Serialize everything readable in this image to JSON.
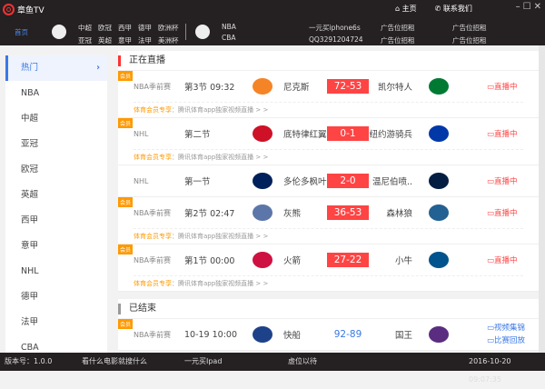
{
  "app": {
    "title": "章鱼TV",
    "home": "主页",
    "contact": "联系我们"
  },
  "nav": {
    "home": "首页",
    "football": [
      "中超",
      "欧冠",
      "西甲",
      "德甲",
      "欧洲杯",
      "亚冠",
      "英超",
      "意甲",
      "法甲",
      "美洲杯"
    ],
    "basketball": [
      "NBA",
      "CBA"
    ],
    "promo1": [
      "一元买iphone6s",
      "QQ3291204724"
    ],
    "ad2": [
      "广告位招租",
      "广告位招租"
    ],
    "ad3": [
      "广告位招租",
      "广告位招租"
    ]
  },
  "sidebar": {
    "items": [
      "热门",
      "NBA",
      "中超",
      "亚冠",
      "欧冠",
      "英超",
      "西甲",
      "意甲",
      "NHL",
      "德甲",
      "法甲",
      "CBA"
    ]
  },
  "live": {
    "title": "正在直播",
    "promo_label": "体育会员专享",
    "promo_text": "：腾讯体育app独家视频直播 > >",
    "badge": "会员",
    "rows": [
      {
        "league": "NBA季前赛",
        "time": "第3节 09:32",
        "home": "尼克斯",
        "score": "72-53",
        "away": "凯尔特人",
        "status": "直播中",
        "home_color": "#f58426",
        "away_color": "#007a33"
      },
      {
        "league": "NHL",
        "time": "第二节",
        "home": "底特律红翼",
        "score": "0-1",
        "away": "纽约游骑兵",
        "status": "直播中",
        "home_color": "#ce1126",
        "away_color": "#0038a8"
      },
      {
        "league": "NHL",
        "time": "第一节",
        "home": "多伦多枫叶",
        "score": "2-0",
        "away": "温尼伯喷..",
        "status": "直播中",
        "home_color": "#00205b",
        "away_color": "#041e42"
      },
      {
        "league": "NBA季前赛",
        "time": "第2节 02:47",
        "home": "灰熊",
        "score": "36-53",
        "away": "森林狼",
        "status": "直播中",
        "home_color": "#5d76a9",
        "away_color": "#236192"
      },
      {
        "league": "NBA季前赛",
        "time": "第1节 00:00",
        "home": "火箭",
        "score": "27-22",
        "away": "小牛",
        "status": "直播中",
        "home_color": "#ce1141",
        "away_color": "#00538c"
      }
    ]
  },
  "ended": {
    "title": "已结束",
    "rows": [
      {
        "league": "NBA季前赛",
        "time": "10-19 10:00",
        "home": "快船",
        "score": "92-89",
        "away": "国王",
        "status": "视频集锦",
        "status2": "比赛回放",
        "home_color": "#1d428a",
        "away_color": "#5a2d81"
      }
    ]
  },
  "footer": {
    "version": "版本号：1.0.0",
    "link1": "看什么电影就搜什么",
    "link2": "一元买Ipad",
    "link3": "虚位以待",
    "datetime": "2016-10-20 09:07:35"
  }
}
